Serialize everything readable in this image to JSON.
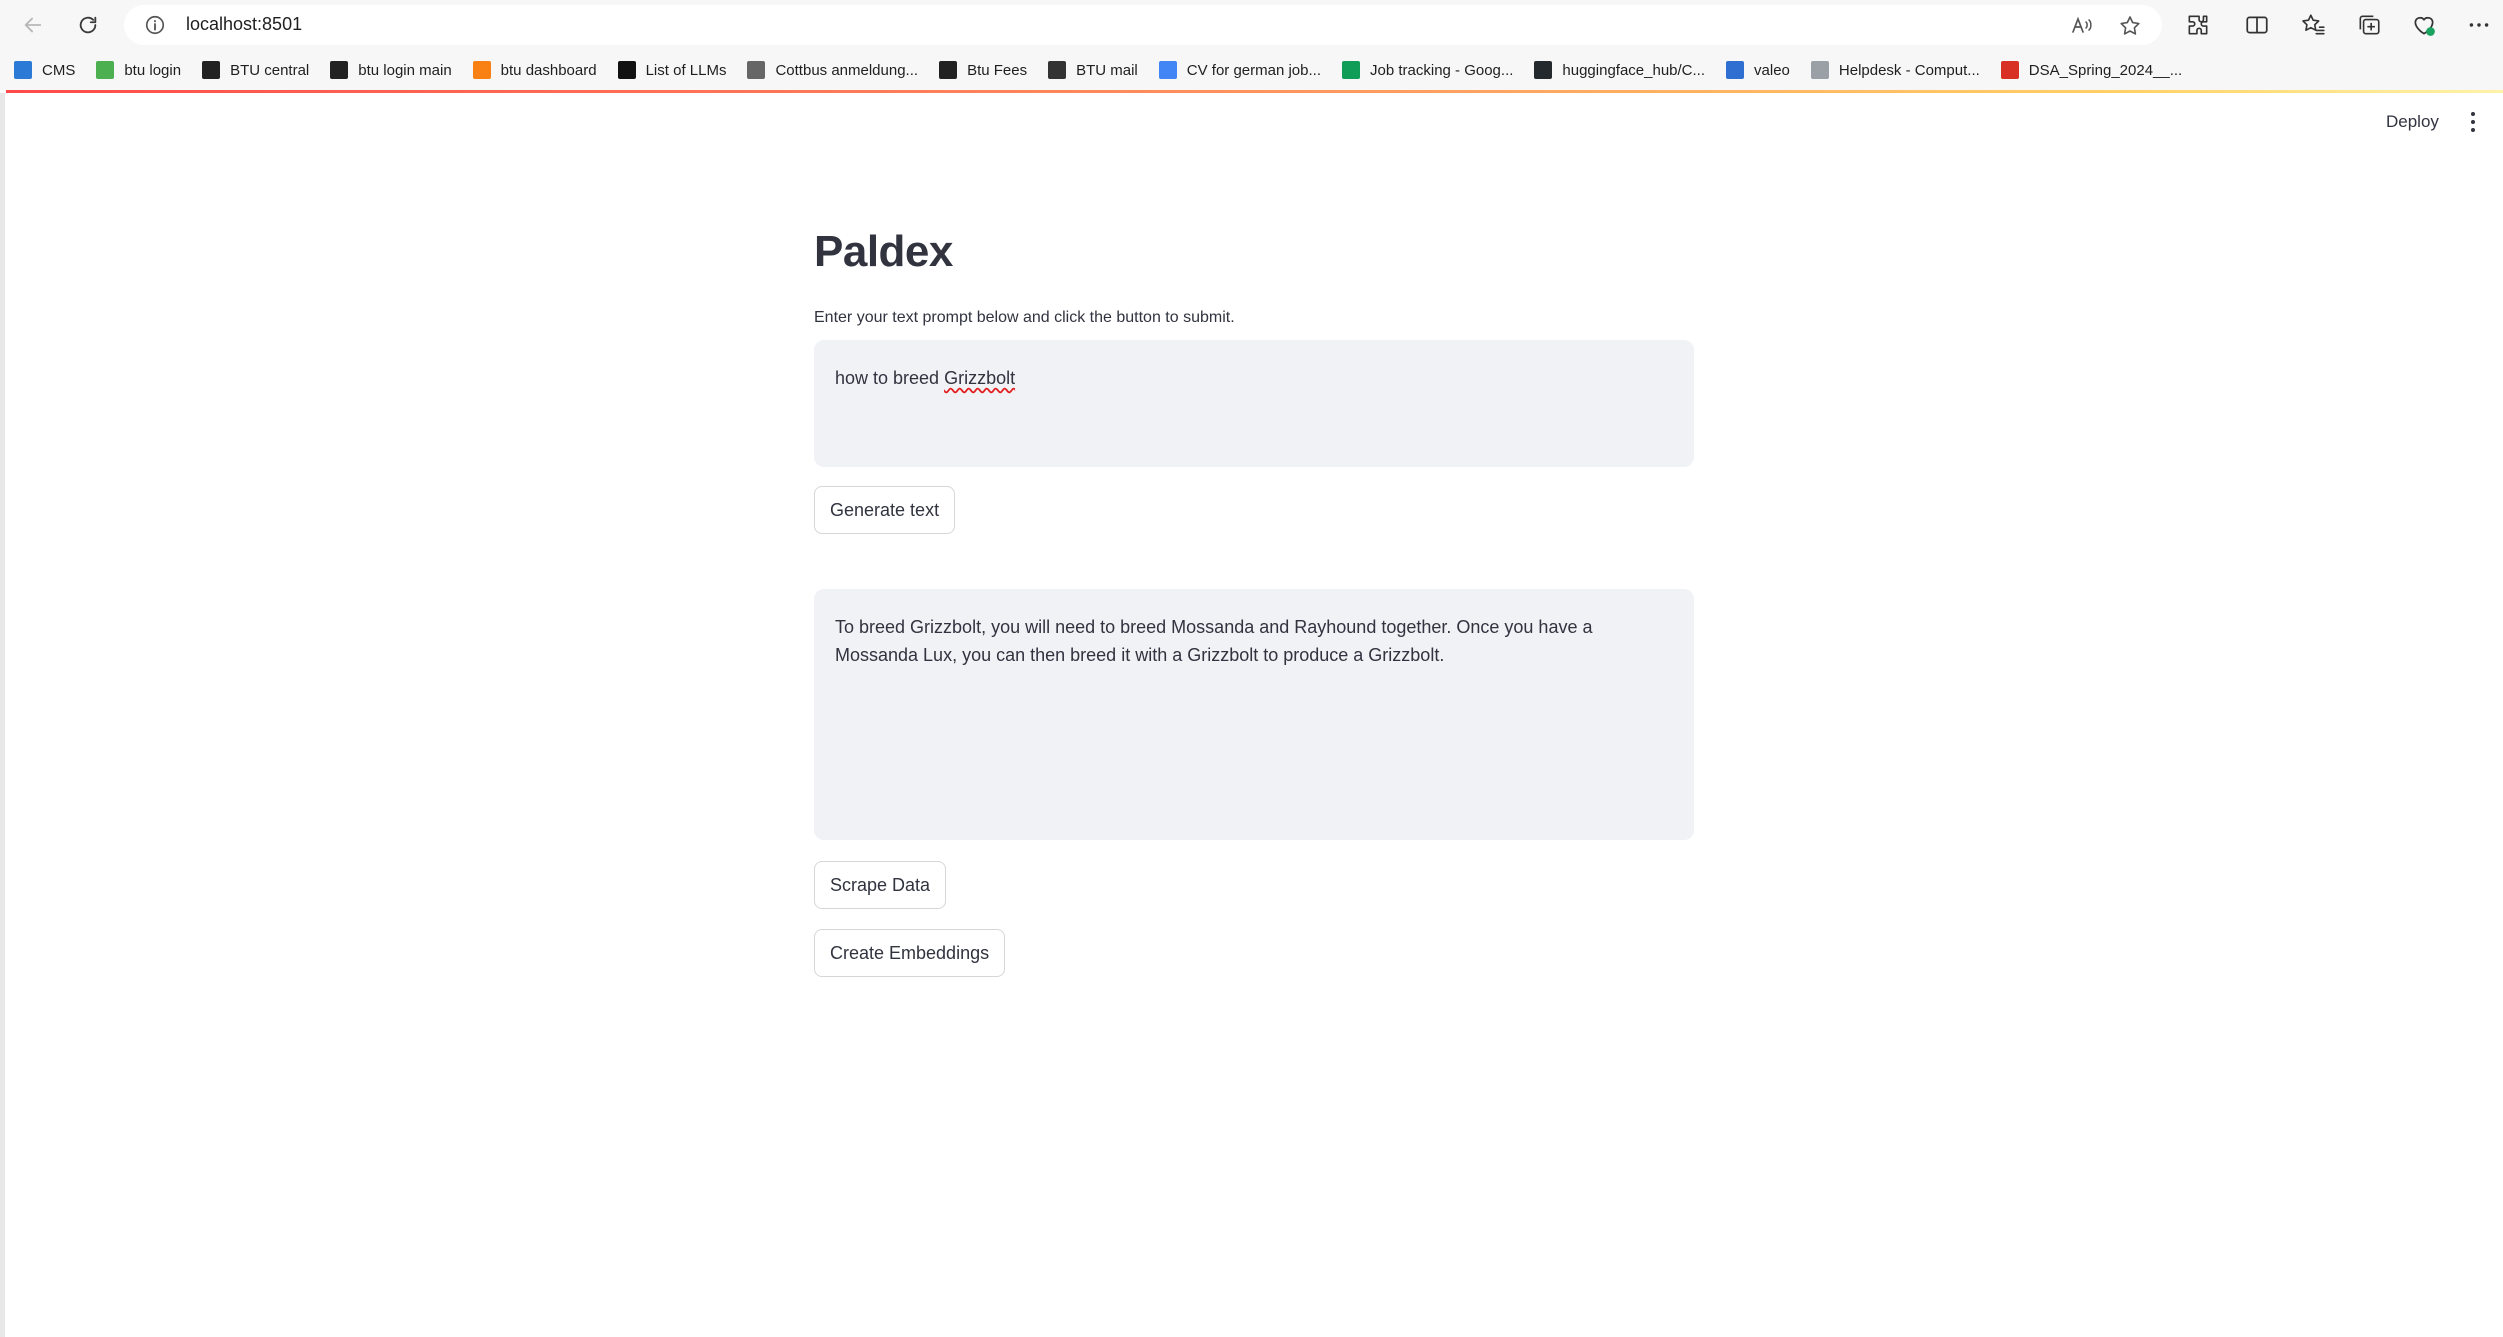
{
  "browser": {
    "url": "localhost:8501",
    "bookmarks": [
      {
        "label": "CMS",
        "icon": "cms-icon",
        "color": "#2b7bd6"
      },
      {
        "label": "btu login",
        "icon": "leaf-icon",
        "color": "#4caf50"
      },
      {
        "label": "BTU central",
        "icon": "btu-icon",
        "color": "#222222"
      },
      {
        "label": "btu login main",
        "icon": "btu-icon",
        "color": "#222222"
      },
      {
        "label": "btu dashboard",
        "icon": "moodle-icon",
        "color": "#f98012"
      },
      {
        "label": "List of LLMs",
        "icon": "eyes-icon",
        "color": "#111111"
      },
      {
        "label": "Cottbus anmeldung...",
        "icon": "document-icon",
        "color": "#666666"
      },
      {
        "label": "Btu Fees",
        "icon": "btu-icon",
        "color": "#222222"
      },
      {
        "label": "BTU mail",
        "icon": "mail-icon",
        "color": "#333333"
      },
      {
        "label": "CV for german job...",
        "icon": "google-docs-icon",
        "color": "#4285f4"
      },
      {
        "label": "Job tracking - Goog...",
        "icon": "google-sheets-icon",
        "color": "#0f9d58"
      },
      {
        "label": "huggingface_hub/C...",
        "icon": "github-icon",
        "color": "#24292e"
      },
      {
        "label": "valeo",
        "icon": "valeo-icon",
        "color": "#2f6fd1"
      },
      {
        "label": "Helpdesk - Comput...",
        "icon": "paperclip-icon",
        "color": "#9aa0a6"
      },
      {
        "label": "DSA_Spring_2024__...",
        "icon": "pdf-icon",
        "color": "#d93025"
      }
    ]
  },
  "header": {
    "deploy_label": "Deploy"
  },
  "main": {
    "title": "Paldex",
    "prompt_label": "Enter your text prompt below and click the button to submit.",
    "prompt_prefix": "how to breed ",
    "prompt_misspelled": "Grizzbolt",
    "generate_label": "Generate text",
    "output_text": "To breed Grizzbolt, you will need to breed Mossanda and Rayhound together. Once you have a Mossanda Lux, you can then breed it with a Grizzbolt to produce a Grizzbolt.",
    "scrape_label": "Scrape Data",
    "embed_label": "Create Embeddings"
  }
}
